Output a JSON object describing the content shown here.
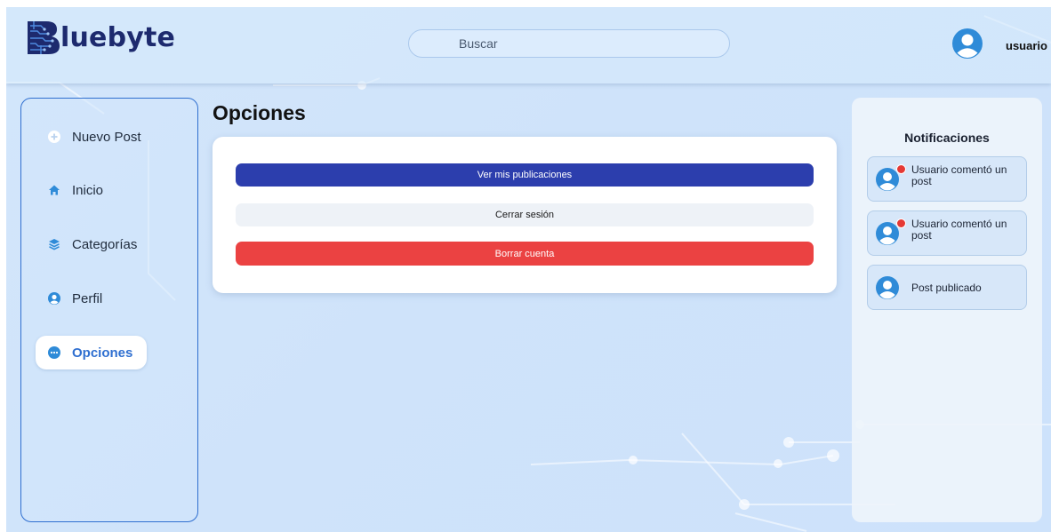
{
  "header": {
    "logo_text": "luebyte",
    "search_placeholder": "Buscar",
    "username": "usuario",
    "icons": {
      "logo": "bluebyte-logo-icon",
      "avatar": "user-avatar-icon"
    }
  },
  "sidebar": {
    "items": [
      {
        "label": "Nuevo Post",
        "icon": "plus-circle-icon",
        "active": false
      },
      {
        "label": "Inicio",
        "icon": "home-icon",
        "active": false
      },
      {
        "label": "Categorías",
        "icon": "layers-icon",
        "active": false
      },
      {
        "label": "Perfil",
        "icon": "user-circle-icon",
        "active": false
      },
      {
        "label": "Opciones",
        "icon": "more-circle-icon",
        "active": true
      }
    ]
  },
  "main": {
    "title": "Opciones",
    "buttons": {
      "view_posts": "Ver mis publicaciones",
      "logout": "Cerrar sesión",
      "delete_account": "Borrar cuenta"
    }
  },
  "notifications": {
    "title": "Notificaciones",
    "items": [
      {
        "text": "Usuario comentó un post",
        "unread": true
      },
      {
        "text": "Usuario comentó un post",
        "unread": true
      },
      {
        "text": "Post publicado",
        "unread": false
      }
    ]
  },
  "colors": {
    "accent": "#2f6fd0",
    "primary_button": "#2c3ead",
    "danger_button": "#eb4242",
    "unread_dot": "#e53935",
    "avatar": "#2f8bd8"
  }
}
